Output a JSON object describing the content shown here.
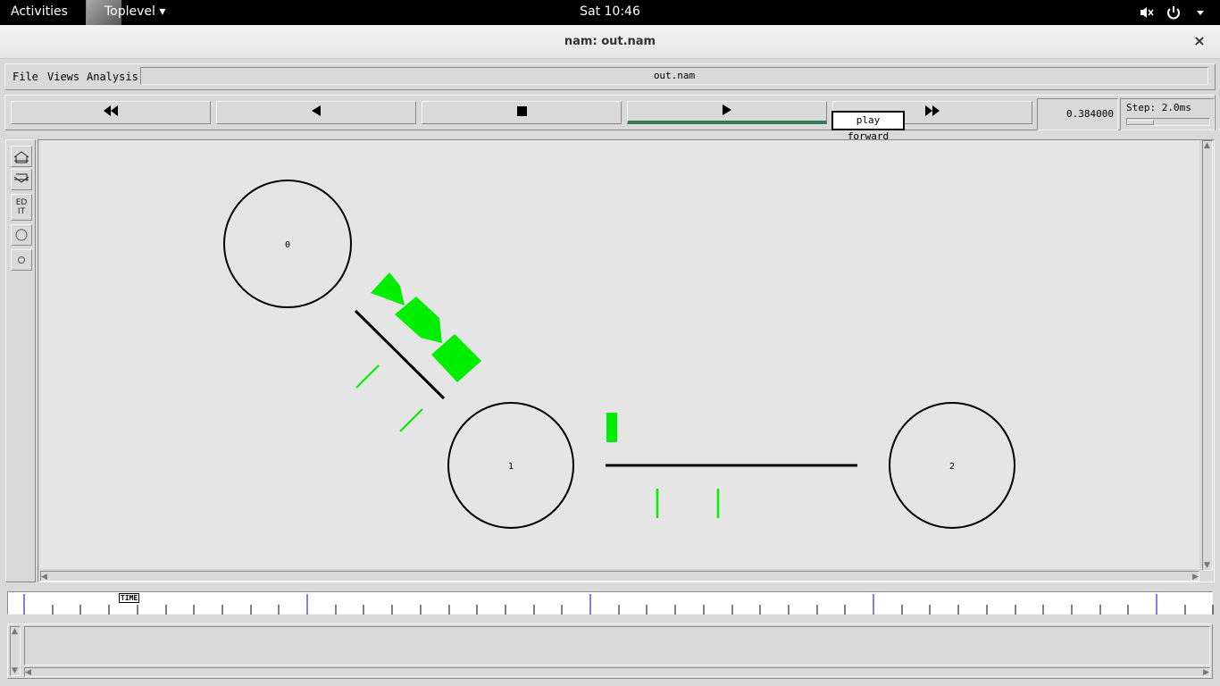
{
  "topbar": {
    "activities": "Activities",
    "app_menu": "Toplevel ▾",
    "clock": "Sat 10:46",
    "tray_icons": [
      "volume-muted-icon",
      "power-icon",
      "chevron-down-icon"
    ]
  },
  "window": {
    "title": "nam: out.nam",
    "close_glyph": "×"
  },
  "menubar": {
    "file": "File",
    "views": "Views",
    "analysis": "Analysis",
    "filename": "out.nam"
  },
  "controls": {
    "rewind": "◀◀",
    "back": "◀",
    "stop": "■",
    "play": "▶",
    "fast_forward": "▶▶",
    "time_value": "0.384000",
    "step_label": "Step: 2.0ms",
    "tooltip": "play forward"
  },
  "toolbox": {
    "edit_label": "ED\nIT"
  },
  "network": {
    "nodes": [
      {
        "label": "0"
      },
      {
        "label": "1"
      },
      {
        "label": "2"
      }
    ],
    "packet_color": "#00ee00"
  },
  "timeline": {
    "marker": "TIME"
  },
  "colors": {
    "accent": "#3a7a5c",
    "packet": "#00ee00",
    "major_tick": "#0000cc"
  }
}
